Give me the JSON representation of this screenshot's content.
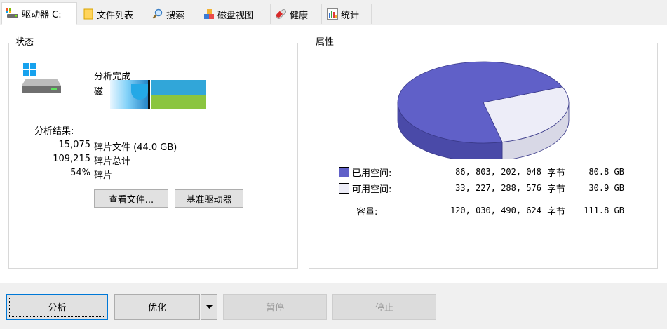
{
  "tabs": [
    {
      "label": "驱动器 C:",
      "icon": "drive-icon"
    },
    {
      "label": "文件列表",
      "icon": "folder-icon"
    },
    {
      "label": "搜索",
      "icon": "search-icon"
    },
    {
      "label": "磁盘视图",
      "icon": "blocks-icon"
    },
    {
      "label": "健康",
      "icon": "health-icon"
    },
    {
      "label": "统计",
      "icon": "stats-icon"
    }
  ],
  "status": {
    "title": "状态",
    "line1": "分析完成",
    "line2": "磁",
    "result_label": "分析结果:",
    "stats": [
      {
        "value": "15,075",
        "label": "碎片文件 (44.0 GB)"
      },
      {
        "value": "109,215",
        "label": "碎片总计"
      },
      {
        "value": "54%",
        "label": "碎片"
      }
    ],
    "view_files_button": "查看文件...",
    "benchmark_button": "基准驱动器"
  },
  "properties": {
    "title": "属性",
    "used": {
      "label": "已用空间:",
      "bytes": "86, 803, 202, 048",
      "unit": "字节",
      "size": "80.8 GB",
      "fraction": 0.723
    },
    "free": {
      "label": "可用空间:",
      "bytes": "33, 227, 288, 576",
      "unit": "字节",
      "size": "30.9 GB",
      "fraction": 0.277
    },
    "capacity": {
      "label": "容量:",
      "bytes": "120, 030, 490, 624",
      "unit": "字节",
      "size": "111.8 GB"
    },
    "colors": {
      "used": "#6060c8",
      "used_side": "#4a4aa8",
      "free": "#ededf8",
      "free_side": "#d8d8e6"
    }
  },
  "bottom": {
    "analyze": "分析",
    "optimize": "优化",
    "pause": "暂停",
    "stop": "停止"
  }
}
